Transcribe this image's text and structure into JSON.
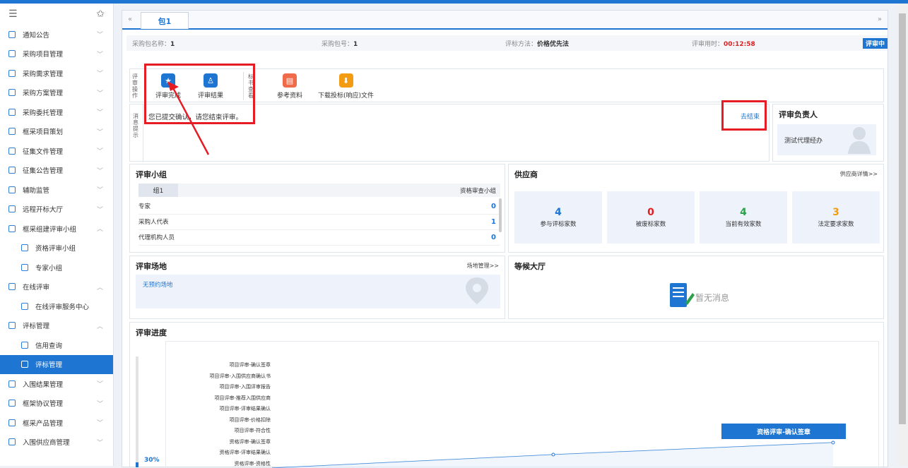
{
  "sidebar": {
    "items": [
      {
        "label": "通知公告",
        "chev": "﹀"
      },
      {
        "label": "采购项目管理",
        "chev": "﹀"
      },
      {
        "label": "采购需求管理",
        "chev": "﹀"
      },
      {
        "label": "采购方案管理",
        "chev": "﹀"
      },
      {
        "label": "采购委托管理",
        "chev": "﹀"
      },
      {
        "label": "框采项目策划",
        "chev": "﹀"
      },
      {
        "label": "征集文件管理",
        "chev": "﹀"
      },
      {
        "label": "征集公告管理",
        "chev": "﹀"
      },
      {
        "label": "辅助监管",
        "chev": "﹀"
      },
      {
        "label": "远程开标大厅",
        "chev": "﹀"
      },
      {
        "label": "框采组建评审小组",
        "chev": "︿"
      },
      {
        "label": "资格评审小组",
        "chev": ""
      },
      {
        "label": "专家小组",
        "chev": ""
      },
      {
        "label": "在线评审",
        "chev": "︿"
      },
      {
        "label": "在线评审服务中心",
        "chev": ""
      },
      {
        "label": "评标管理",
        "chev": "︿"
      },
      {
        "label": "信用查询",
        "chev": ""
      },
      {
        "label": "评标管理",
        "chev": ""
      },
      {
        "label": "入围结果管理",
        "chev": "﹀"
      },
      {
        "label": "框架协议管理",
        "chev": "﹀"
      },
      {
        "label": "框采产品管理",
        "chev": "﹀"
      },
      {
        "label": "入围供应商管理",
        "chev": "﹀"
      }
    ]
  },
  "tab": {
    "label": "包1"
  },
  "info": {
    "pkg_name_label": "采购包名称：",
    "pkg_name": "1",
    "pkg_no_label": "采购包号：",
    "pkg_no": "1",
    "method_label": "评标方法：",
    "method": "价格优先法",
    "time_label": "评审用时：",
    "time": "00:12:58",
    "status": "评审中"
  },
  "ops": {
    "review_label": "评审操作",
    "btn1": "评审完成",
    "btn2": "评审结果",
    "ref_label": "标书查看",
    "btn3": "参考资料",
    "btn4": "下载投标(响应)文件"
  },
  "msg": {
    "label": "消息提示",
    "text": "您已提交确认，请您结束评审。",
    "action": "去结束"
  },
  "leader": {
    "title": "评审负责人",
    "name": "测试代理经办"
  },
  "group": {
    "title": "评审小组",
    "tab": "组1",
    "right": "资格审查小组",
    "rows": [
      {
        "label": "专家",
        "value": "0"
      },
      {
        "label": "采购人代表",
        "value": "1"
      },
      {
        "label": "代理机构人员",
        "value": "0"
      }
    ]
  },
  "supplier": {
    "title": "供应商",
    "link": "供应商详情>>",
    "stats": [
      {
        "num": "4",
        "label": "参与评标家数",
        "color": "#1f76d2"
      },
      {
        "num": "0",
        "label": "被废标家数",
        "color": "#e02020"
      },
      {
        "num": "4",
        "label": "当前有效家数",
        "color": "#2aa14a"
      },
      {
        "num": "3",
        "label": "法定要求家数",
        "color": "#f39c12"
      }
    ]
  },
  "venue": {
    "title": "评审场地",
    "link": "场地管理>>",
    "empty": "无预约场地"
  },
  "hall": {
    "title": "等候大厅",
    "empty": "暂无消息"
  },
  "progress": {
    "title": "评审进度",
    "percent": "30%",
    "steps": [
      "项目评审-确认签章",
      "项目评审-入围供应商确认书",
      "项目评审-入围评审报告",
      "项目评审-推荐入围供应商",
      "项目评审-评审结果确认",
      "项目评审-价格扣除",
      "项目评审-符合性",
      "资格评审-确认签章",
      "资格评审-评审结果确认",
      "资格评审-资格性"
    ],
    "current": "资格评审-确认签章"
  }
}
